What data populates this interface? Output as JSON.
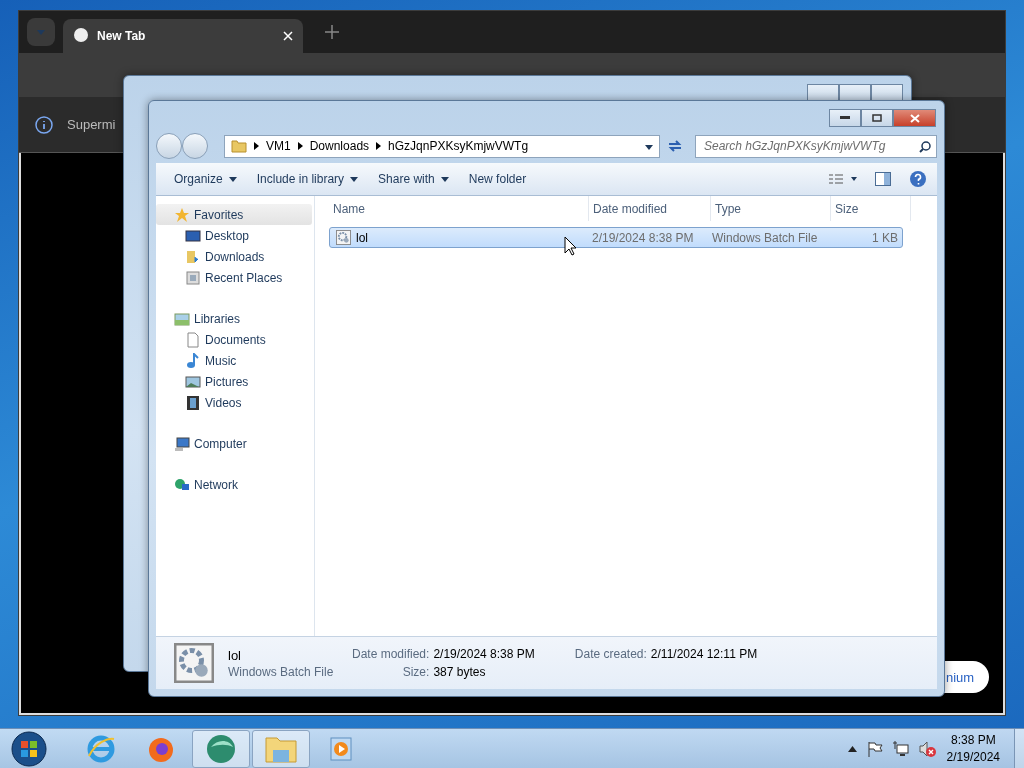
{
  "browser": {
    "tab": {
      "title": "New Tab",
      "selected": true
    },
    "infobar": {
      "text": "Supermi"
    },
    "page_button": {
      "label": "nium"
    }
  },
  "back_window": {
    "kind": "explorer"
  },
  "explorer": {
    "breadcrumb": [
      "VM1",
      "Downloads",
      "hGzJqnPXKsyKmjwVWTg"
    ],
    "search": {
      "placeholder": "Search hGzJqnPXKsyKmjwVWTg"
    },
    "toolbar": [
      {
        "label": "Organize",
        "dropdown": true
      },
      {
        "label": "Include in library",
        "dropdown": true
      },
      {
        "label": "Share with",
        "dropdown": true
      },
      {
        "label": "New folder",
        "dropdown": false
      }
    ],
    "nav": [
      {
        "label": "Favorites",
        "selected": true,
        "children": [
          {
            "label": "Desktop"
          },
          {
            "label": "Downloads"
          },
          {
            "label": "Recent Places"
          }
        ]
      },
      {
        "label": "Libraries",
        "selected": false,
        "children": [
          {
            "label": "Documents"
          },
          {
            "label": "Music"
          },
          {
            "label": "Pictures"
          },
          {
            "label": "Videos"
          }
        ]
      },
      {
        "label": "Computer",
        "selected": false
      },
      {
        "label": "Network",
        "selected": false
      }
    ],
    "columns": [
      "Name",
      "Date modified",
      "Type",
      "Size"
    ],
    "files": [
      {
        "name": "lol",
        "date": "2/19/2024 8:38 PM",
        "type": "Windows Batch File",
        "size": "1 KB",
        "selected": true
      }
    ],
    "details": {
      "name": "lol",
      "type": "Windows Batch File",
      "fields": [
        {
          "label": "Date modified:",
          "value": "2/19/2024 8:38 PM"
        },
        {
          "label": "Date created:",
          "value": "2/11/2024 12:11 PM"
        },
        {
          "label": "Size:",
          "value": "387 bytes"
        }
      ]
    }
  },
  "taskbar": {
    "apps": [
      {
        "pressed": false
      },
      {
        "pressed": false
      },
      {
        "pressed": true
      },
      {
        "pressed": true
      },
      {
        "pressed": false
      }
    ],
    "clock": {
      "time": "8:38 PM",
      "date": "2/19/2024"
    }
  }
}
